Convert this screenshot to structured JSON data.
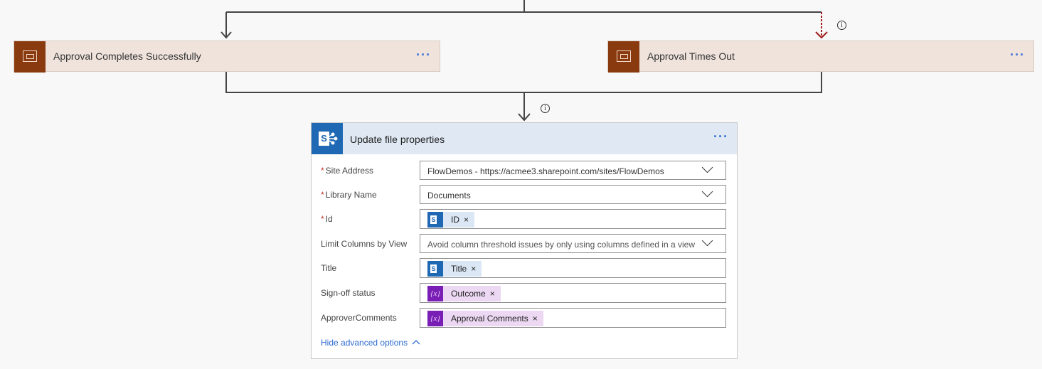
{
  "scopes": {
    "left": {
      "title": "Approval Completes Successfully",
      "menu": "···"
    },
    "right": {
      "title": "Approval Times Out",
      "menu": "···"
    }
  },
  "info_glyph": "i",
  "card": {
    "title": "Update file properties",
    "menu": "···",
    "fields": [
      {
        "label": "Site Address",
        "required": true,
        "value": "FlowDemos - https://acmee3.sharepoint.com/sites/FlowDemos",
        "type": "dropdown"
      },
      {
        "label": "Library Name",
        "required": true,
        "value": "Documents",
        "type": "dropdown"
      },
      {
        "label": "Id",
        "required": true,
        "token": "ID",
        "token_kind": "sharepoint",
        "type": "token"
      },
      {
        "label": "Limit Columns by View",
        "required": false,
        "value": "Avoid column threshold issues by only using columns defined in a view",
        "type": "dropdown"
      },
      {
        "label": "Title",
        "required": false,
        "token": "Title",
        "token_kind": "sharepoint",
        "type": "token"
      },
      {
        "label": "Sign-off status",
        "required": false,
        "token": "Outcome",
        "token_kind": "variable",
        "type": "token"
      },
      {
        "label": "ApproverComments",
        "required": false,
        "token": "Approval Comments",
        "token_kind": "variable",
        "type": "token"
      }
    ],
    "hide_advanced": "Hide advanced options"
  },
  "req_mark": "*",
  "remove_mark": "×",
  "var_glyph": "{x}",
  "sp_glyph": "S",
  "colors": {
    "scope_fill": "#efe3dc",
    "scope_icon": "#8a3a0f",
    "card_header": "#dfe8f3",
    "sharepoint": "#1f68b4",
    "variable": "#7a1fb6",
    "timeout_arrow": "#a01b1b",
    "link": "#2e6bd1"
  }
}
